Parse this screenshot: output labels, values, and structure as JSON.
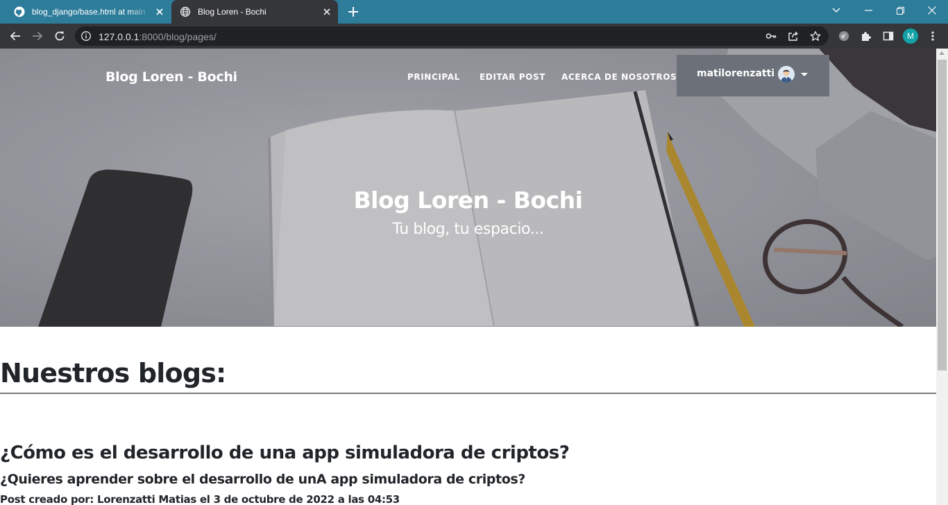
{
  "browser": {
    "tabs": [
      {
        "title": "blog_django/base.html at main · ",
        "favicon": "github-icon",
        "active": false
      },
      {
        "title": "Blog Loren - Bochi",
        "favicon": "globe-icon",
        "active": true
      }
    ],
    "url_host": "127.0.0.1",
    "url_rest": ":8000/blog/pages/",
    "profile_initial": "M",
    "colors": {
      "tabstrip": "#2d7c9a",
      "toolbar": "#35363a",
      "omnibox": "#202124",
      "profile": "#12a3a8"
    }
  },
  "site": {
    "brand": "Blog Loren - Bochi",
    "nav": [
      "PRINCIPAL",
      "EDITAR POST",
      "ACERCA DE NOSOTROS"
    ],
    "user": {
      "name": "matilorenzatti",
      "avatar": "user-avatar",
      "menu_icon": "caret-down-icon"
    },
    "hero": {
      "title": "Blog Loren - Bochi",
      "subtitle": "Tu blog, tu espacio..."
    }
  },
  "content": {
    "section_title": "Nuestros blogs:",
    "posts": [
      {
        "title": "¿Cómo es el desarrollo de una app simuladora de criptos?",
        "subtitle": "¿Quieres aprender sobre el desarrollo de unA app simuladora de criptos?",
        "meta": "Post creado por: Lorenzatti Matias el 3 de octubre de 2022 a las 04:53"
      }
    ]
  }
}
